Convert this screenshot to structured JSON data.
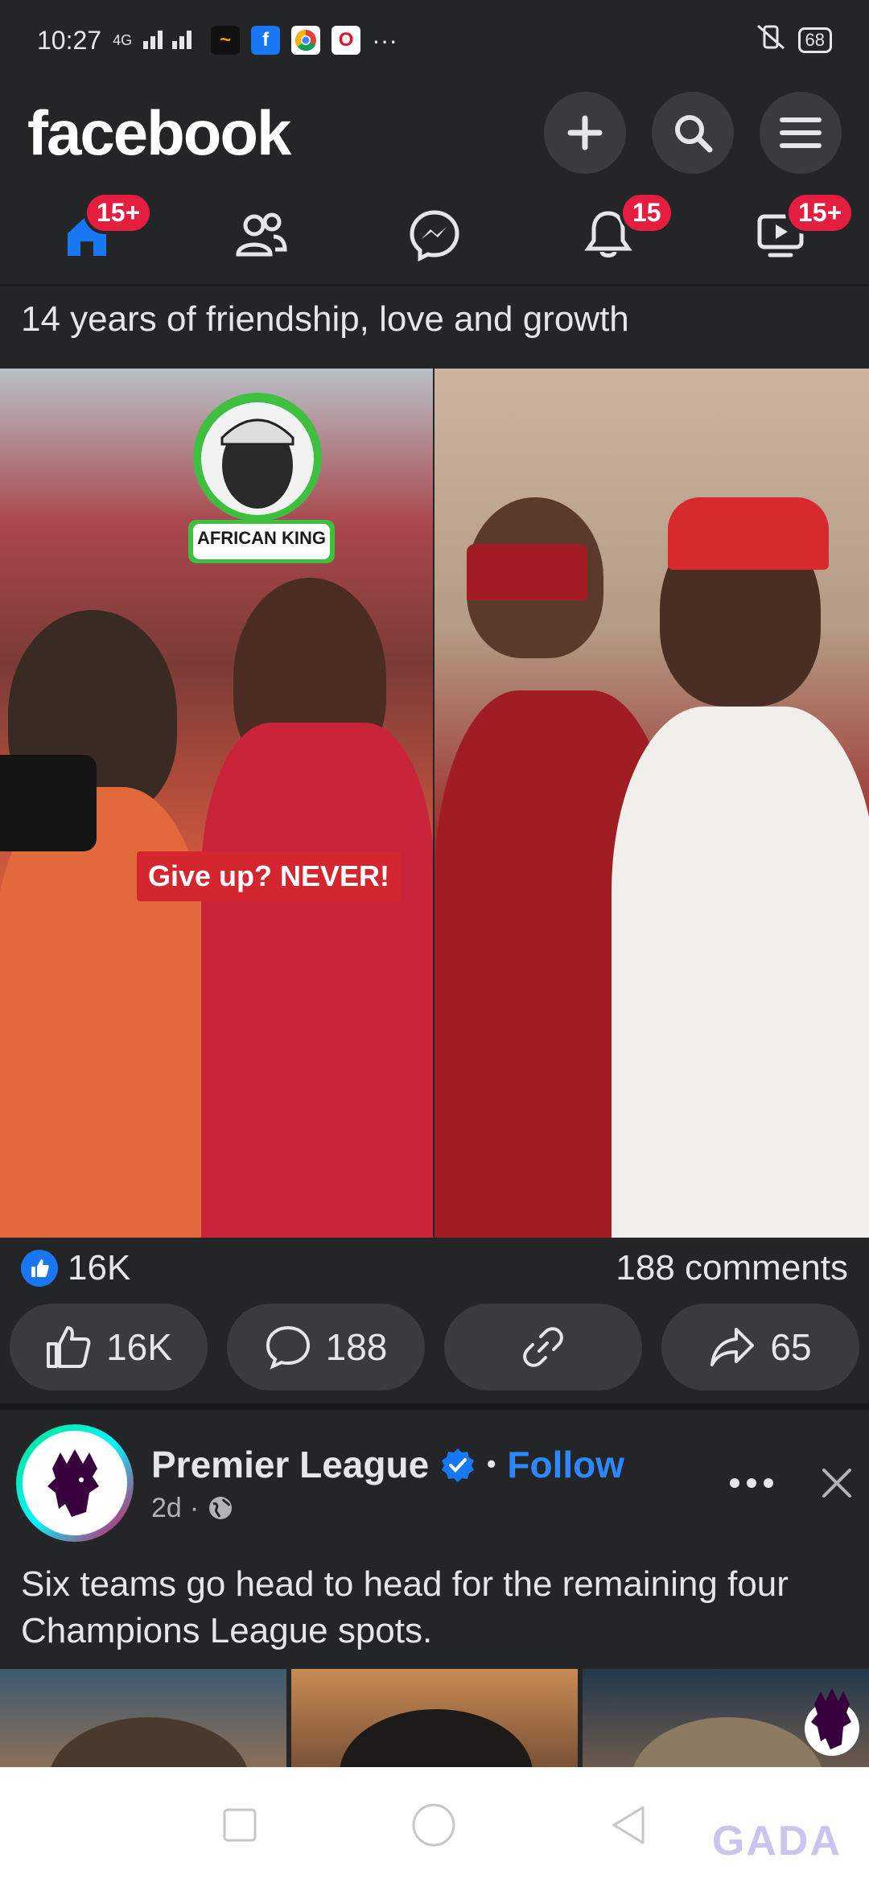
{
  "status_bar": {
    "time": "10:27",
    "network": "4G",
    "battery": "68",
    "more": "···"
  },
  "header": {
    "logo": "facebook"
  },
  "nav": {
    "home_badge": "15+",
    "notifications_badge": "15",
    "video_badge": "15+"
  },
  "post1": {
    "caption": "14 years of friendship, love and growth",
    "overlay_text": "Give up? NEVER!",
    "logo_text": "AFRICAN KING",
    "likes": "16K",
    "comments": "188 comments",
    "actions": {
      "like": "16K",
      "comment": "188",
      "share": "65"
    }
  },
  "post2": {
    "author": "Premier League",
    "follow": "Follow",
    "separator": "•",
    "time": "2d",
    "text": "Six teams go head to head for the remaining four Champions League spots."
  },
  "watermark": "GADA",
  "colors": {
    "bg": "#242526",
    "accent": "#1877f2",
    "badge": "#e41e3f",
    "follow": "#2d88ff"
  }
}
